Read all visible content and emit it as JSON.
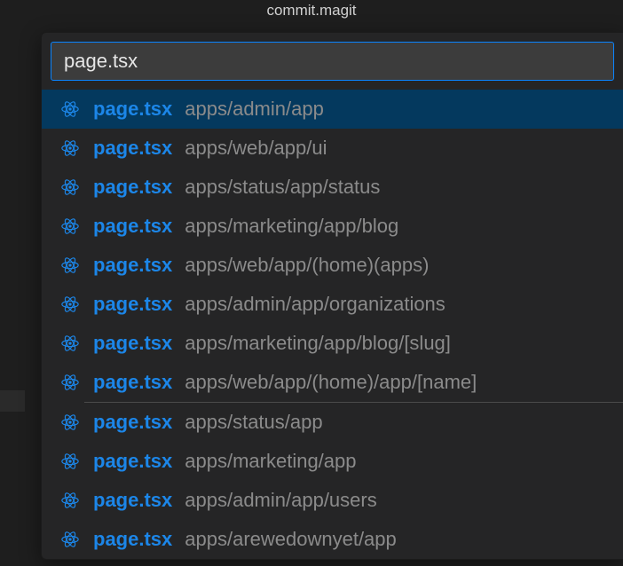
{
  "window": {
    "title": "commit.magit"
  },
  "quickopen": {
    "query": "page.tsx",
    "selected_index": 0,
    "separator_after_index": 7,
    "results": [
      {
        "icon": "react-ts-icon",
        "filename": "page.tsx",
        "path": "apps/admin/app"
      },
      {
        "icon": "react-ts-icon",
        "filename": "page.tsx",
        "path": "apps/web/app/ui"
      },
      {
        "icon": "react-ts-icon",
        "filename": "page.tsx",
        "path": "apps/status/app/status"
      },
      {
        "icon": "react-ts-icon",
        "filename": "page.tsx",
        "path": "apps/marketing/app/blog"
      },
      {
        "icon": "react-ts-icon",
        "filename": "page.tsx",
        "path": "apps/web/app/(home)(apps)"
      },
      {
        "icon": "react-ts-icon",
        "filename": "page.tsx",
        "path": "apps/admin/app/organizations"
      },
      {
        "icon": "react-ts-icon",
        "filename": "page.tsx",
        "path": "apps/marketing/app/blog/[slug]"
      },
      {
        "icon": "react-ts-icon",
        "filename": "page.tsx",
        "path": "apps/web/app/(home)/app/[name]"
      },
      {
        "icon": "react-ts-icon",
        "filename": "page.tsx",
        "path": "apps/status/app"
      },
      {
        "icon": "react-ts-icon",
        "filename": "page.tsx",
        "path": "apps/marketing/app"
      },
      {
        "icon": "react-ts-icon",
        "filename": "page.tsx",
        "path": "apps/admin/app/users"
      },
      {
        "icon": "react-ts-icon",
        "filename": "page.tsx",
        "path": "apps/arewedownyet/app"
      }
    ]
  },
  "colors": {
    "accent": "#0a84ff",
    "filename": "#1c86e8",
    "path": "#8b8b8b",
    "row_selected_bg": "#04395e"
  }
}
